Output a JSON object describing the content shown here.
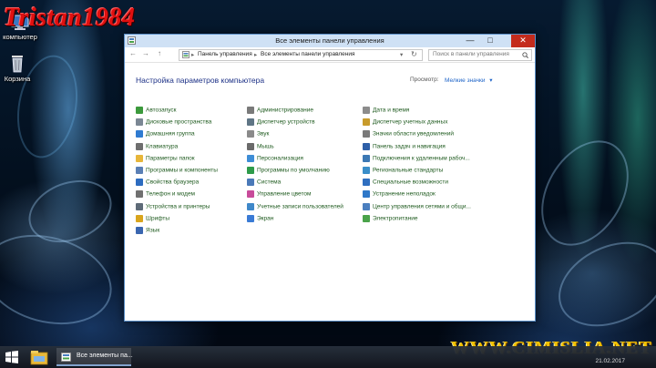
{
  "watermarks": {
    "top": "Tristan1984",
    "bottom": "WWW.CIMISLIA.NET"
  },
  "desktop": {
    "icons": [
      {
        "label": "компьютер",
        "icon": "computer-icon"
      },
      {
        "label": "Корзина",
        "icon": "recycle-bin-icon"
      }
    ]
  },
  "window": {
    "title": "Все элементы панели управления",
    "controls": {
      "minimize": "—",
      "maximize": "□",
      "close": "✕"
    },
    "nav": {
      "back": "←",
      "forward": "→",
      "up": "↑"
    },
    "address": {
      "crumbs": [
        "Панель управления",
        "Все элементы панели управления"
      ],
      "separator": "▸",
      "dropdown": "▾",
      "refresh": "↻"
    },
    "search": {
      "placeholder": "Поиск в панели управления",
      "icon": "search-icon"
    },
    "heading": "Настройка параметров компьютера",
    "view_by": {
      "label": "Просмотр:",
      "value": "Мелкие значки",
      "caret": "▾"
    }
  },
  "items": {
    "col1": [
      {
        "label": "Автозапуск",
        "icon": "autoplay-icon",
        "color": "#3c9a3c"
      },
      {
        "label": "Дисковые пространства",
        "icon": "storage-spaces-icon",
        "color": "#7b8794"
      },
      {
        "label": "Домашняя группа",
        "icon": "homegroup-icon",
        "color": "#2f7bd1"
      },
      {
        "label": "Клавиатура",
        "icon": "keyboard-icon",
        "color": "#6e6e6e"
      },
      {
        "label": "Параметры папок",
        "icon": "folder-options-icon",
        "color": "#e7b63a"
      },
      {
        "label": "Программы и компоненты",
        "icon": "programs-icon",
        "color": "#5a7fb5"
      },
      {
        "label": "Свойства браузера",
        "icon": "internet-options-icon",
        "color": "#2d6cc0"
      },
      {
        "label": "Телефон и модем",
        "icon": "phone-modem-icon",
        "color": "#707070"
      },
      {
        "label": "Устройства и принтеры",
        "icon": "devices-printers-icon",
        "color": "#5e6b78"
      },
      {
        "label": "Шрифты",
        "icon": "fonts-icon",
        "color": "#d9a51d"
      },
      {
        "label": "Язык",
        "icon": "language-icon",
        "color": "#3a66b0"
      }
    ],
    "col2": [
      {
        "label": "Администрирование",
        "icon": "admin-tools-icon",
        "color": "#7a7a7a"
      },
      {
        "label": "Диспетчер устройств",
        "icon": "device-manager-icon",
        "color": "#5f7585"
      },
      {
        "label": "Звук",
        "icon": "sound-icon",
        "color": "#8a8a8a"
      },
      {
        "label": "Мышь",
        "icon": "mouse-icon",
        "color": "#6a6a6a"
      },
      {
        "label": "Персонализация",
        "icon": "personalization-icon",
        "color": "#3e8dd6"
      },
      {
        "label": "Программы по умолчанию",
        "icon": "default-programs-icon",
        "color": "#2e9b4a"
      },
      {
        "label": "Система",
        "icon": "system-icon",
        "color": "#4a79b8"
      },
      {
        "label": "Управление цветом",
        "icon": "color-management-icon",
        "color": "#c84b9a"
      },
      {
        "label": "Учетные записи пользователей",
        "icon": "user-accounts-icon",
        "color": "#3f88c9"
      },
      {
        "label": "Экран",
        "icon": "display-icon",
        "color": "#3a7bd5"
      }
    ],
    "col3": [
      {
        "label": "Дата и время",
        "icon": "date-time-icon",
        "color": "#8c8c8c"
      },
      {
        "label": "Диспетчер учетных данных",
        "icon": "credential-manager-icon",
        "color": "#c89b2b"
      },
      {
        "label": "Значки области уведомлений",
        "icon": "notification-icons-icon",
        "color": "#7a7a7a"
      },
      {
        "label": "Панель задач и навигация",
        "icon": "taskbar-navigation-icon",
        "color": "#2e5fa8"
      },
      {
        "label": "Подключения к удаленным рабоч...",
        "icon": "remote-desktop-icon",
        "color": "#3c78b4"
      },
      {
        "label": "Региональные стандарты",
        "icon": "region-icon",
        "color": "#3a8ec9"
      },
      {
        "label": "Специальные возможности",
        "icon": "ease-of-access-icon",
        "color": "#2f6fc0"
      },
      {
        "label": "Устранение неполадок",
        "icon": "troubleshooting-icon",
        "color": "#2f78c8"
      },
      {
        "label": "Центр управления сетями и общи...",
        "icon": "network-center-icon",
        "color": "#4b7fbf"
      },
      {
        "label": "Электропитание",
        "icon": "power-options-icon",
        "color": "#4aa34a"
      }
    ]
  },
  "taskbar": {
    "start": "start-icon",
    "pinned": "file-explorer-icon",
    "open_app": "Все элементы па...",
    "clock": "21.02.2017"
  }
}
